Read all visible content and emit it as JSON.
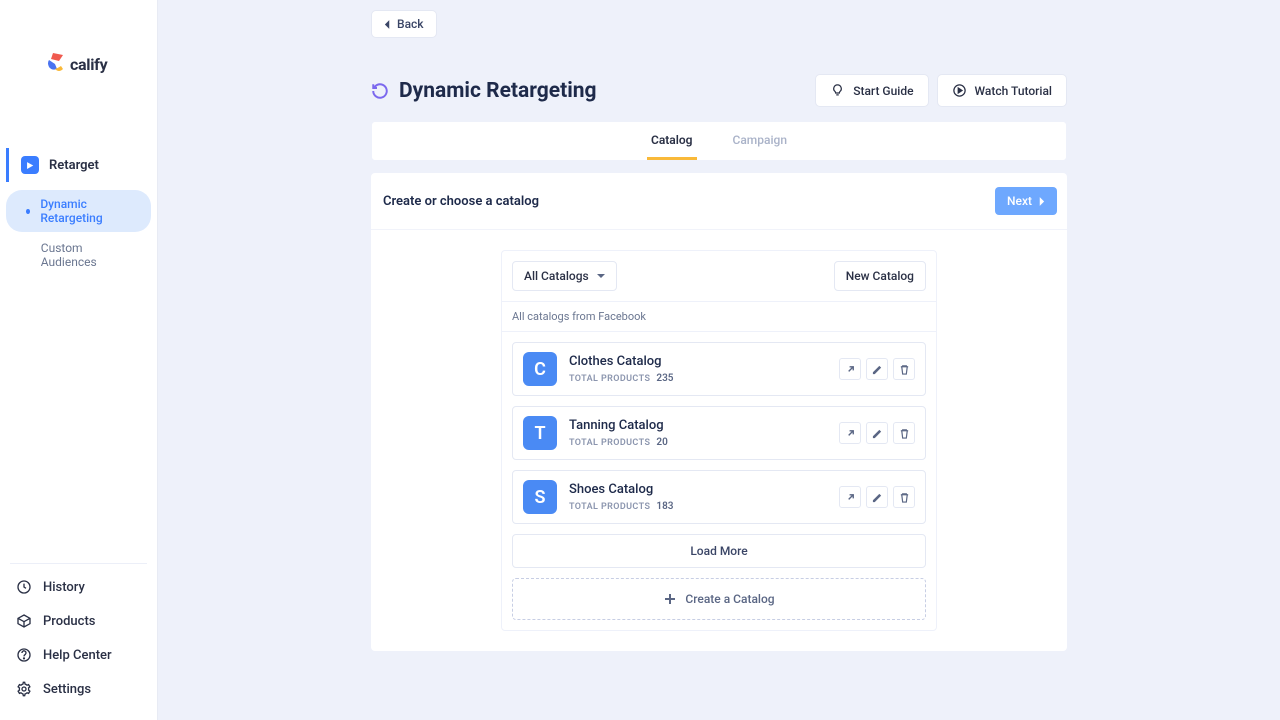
{
  "brand": "calify",
  "sidebar": {
    "main_label": "Retarget",
    "items": [
      {
        "label": "Dynamic Retargeting"
      },
      {
        "label": "Custom Audiences"
      }
    ],
    "bottom": [
      {
        "label": "History"
      },
      {
        "label": "Products"
      },
      {
        "label": "Help Center"
      },
      {
        "label": "Settings"
      }
    ]
  },
  "back_label": "Back",
  "page_title": "Dynamic Retargeting",
  "header": {
    "start_guide": "Start Guide",
    "watch_tutorial": "Watch Tutorial"
  },
  "tabs": [
    {
      "label": "Catalog",
      "active": true
    },
    {
      "label": "Campaign",
      "active": false
    }
  ],
  "card": {
    "title": "Create or choose a catalog",
    "next": "Next",
    "filter_label": "All Catalogs",
    "new_catalog": "New Catalog",
    "source_label": "All catalogs from Facebook",
    "total_products_label": "TOTAL PRODUCTS",
    "catalogs": [
      {
        "letter": "C",
        "name": "Clothes Catalog",
        "count": "235"
      },
      {
        "letter": "T",
        "name": "Tanning Catalog",
        "count": "20"
      },
      {
        "letter": "S",
        "name": "Shoes Catalog",
        "count": "183"
      }
    ],
    "load_more": "Load More",
    "create_catalog": "Create a Catalog"
  }
}
